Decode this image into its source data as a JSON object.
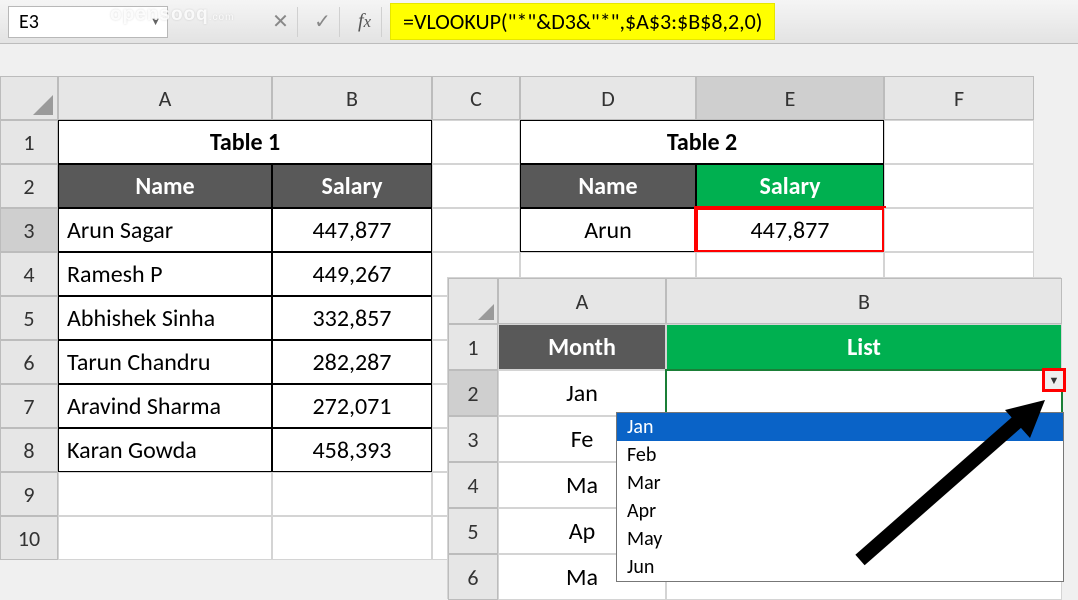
{
  "formula_bar": {
    "cell_ref": "E3",
    "formula": "=VLOOKUP(\"*\"&D3&\"*\",$A$3:$B$8,2,0)"
  },
  "watermark": {
    "text": "opensooq",
    "suffix": ".com"
  },
  "sheet1": {
    "cols": [
      "A",
      "B",
      "C",
      "D",
      "E",
      "F"
    ],
    "rows": [
      "1",
      "2",
      "3",
      "4",
      "5",
      "6",
      "7",
      "8",
      "9",
      "10"
    ],
    "table1": {
      "title": "Table 1",
      "headers": {
        "name": "Name",
        "salary": "Salary"
      },
      "data": [
        {
          "name": "Arun Sagar",
          "salary": "447,877"
        },
        {
          "name": "Ramesh P",
          "salary": "449,267"
        },
        {
          "name": "Abhishek Sinha",
          "salary": "332,857"
        },
        {
          "name": "Tarun Chandru",
          "salary": "282,287"
        },
        {
          "name": "Aravind Sharma",
          "salary": "272,071"
        },
        {
          "name": "Karan Gowda",
          "salary": "458,393"
        }
      ]
    },
    "table2": {
      "title": "Table 2",
      "headers": {
        "name": "Name",
        "salary": "Salary"
      },
      "data": [
        {
          "name": "Arun",
          "salary": "447,877"
        }
      ]
    }
  },
  "sheet2": {
    "cols": [
      "A",
      "B"
    ],
    "rows": [
      "1",
      "2",
      "3",
      "4",
      "5",
      "6"
    ],
    "headers": {
      "month": "Month",
      "list": "List"
    },
    "months": [
      "Jan",
      "Fe",
      "Ma",
      "Ap",
      "Ma"
    ],
    "dropdown": {
      "selected": "Jan",
      "options": [
        "Jan",
        "Feb",
        "Mar",
        "Apr",
        "May",
        "Jun"
      ]
    }
  }
}
